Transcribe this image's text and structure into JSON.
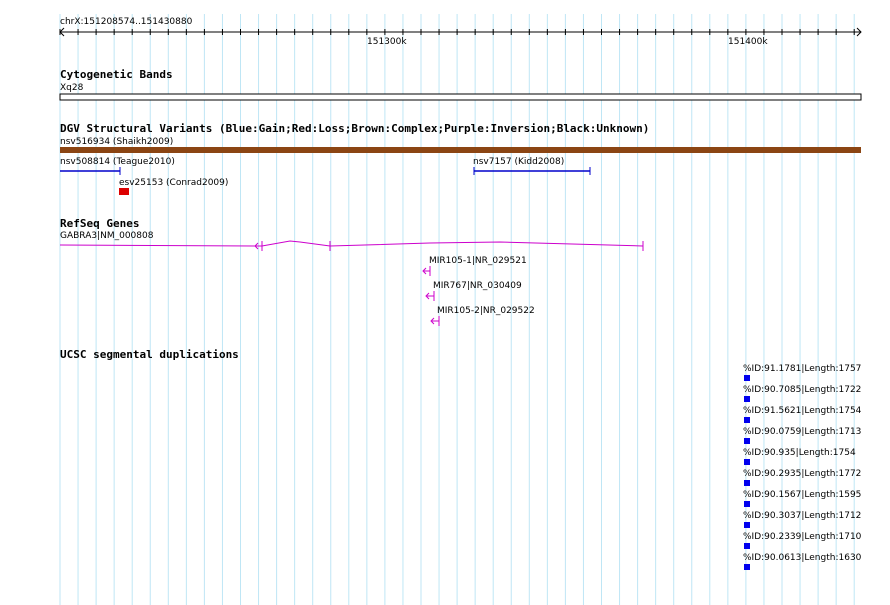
{
  "coordinates": "chrX:151208574..151430880",
  "ruler": {
    "tick_labels": [
      "151300k",
      "151400k"
    ]
  },
  "tracks": {
    "cytoband": {
      "title": "Cytogenetic Bands",
      "band": "Xq28"
    },
    "dgv": {
      "title": "DGV Structural Variants (Blue:Gain;Red:Loss;Brown:Complex;Purple:Inversion;Black:Unknown)",
      "features": [
        {
          "label": "nsv516934 (Shaikh2009)",
          "color": "#8b4513"
        },
        {
          "label": "nsv508814 (Teague2010)",
          "color": "#0000cc"
        },
        {
          "label": "nsv7157 (Kidd2008)",
          "color": "#0000cc"
        },
        {
          "label": "esv25153 (Conrad2009)",
          "color": "#dd0000"
        }
      ]
    },
    "refseq": {
      "title": "RefSeq Genes",
      "color": "#cc00cc",
      "genes": [
        "GABRA3|NM_000808",
        "MIR105-1|NR_029521",
        "MIR767|NR_030409",
        "MIR105-2|NR_029522"
      ]
    },
    "segdup": {
      "title": "UCSC segmental duplications",
      "color": "#0000ee",
      "features": [
        "%ID:91.1781|Length:1757",
        "%ID:90.7085|Length:1722",
        "%ID:91.5621|Length:1754",
        "%ID:90.0759|Length:1713",
        "%ID:90.935|Length:1754",
        "%ID:90.2935|Length:1772",
        "%ID:90.1567|Length:1595",
        "%ID:90.3037|Length:1712",
        "%ID:90.2339|Length:1710",
        "%ID:90.0613|Length:1630"
      ]
    }
  }
}
